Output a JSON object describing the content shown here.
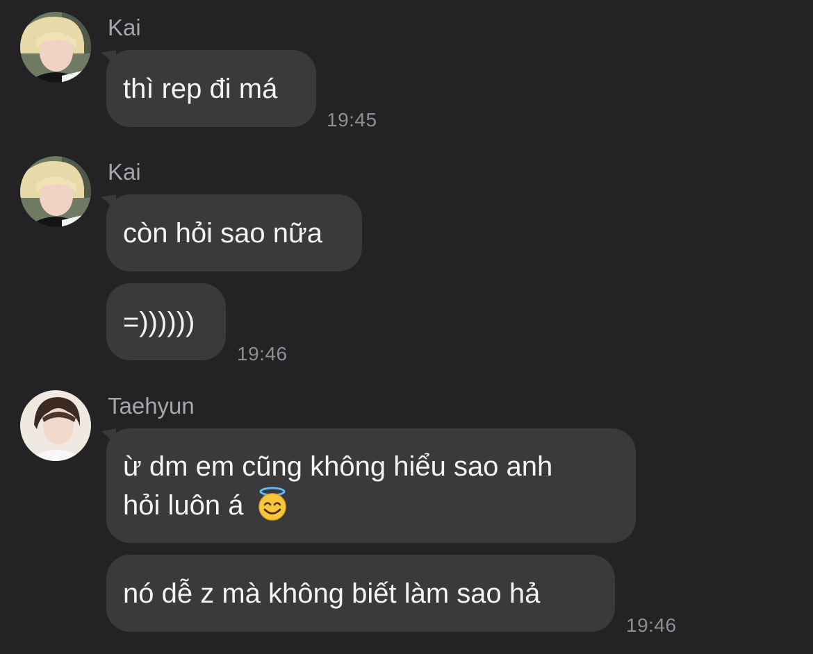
{
  "messages": [
    {
      "sender": "Kai",
      "bubbles": [
        "thì rep đi má"
      ],
      "time": "19:45"
    },
    {
      "sender": "Kai",
      "bubbles": [
        "còn hỏi sao nữa",
        "=))))))"
      ],
      "time": "19:46"
    },
    {
      "sender": "Taehyun",
      "bubbles": [
        {
          "line1": "ừ dm em cũng không hiểu sao anh",
          "line2": "hỏi luôn á",
          "emoji": "smiling-face-with-halo"
        },
        "nó dễ z mà không biết làm sao hả"
      ],
      "time": "19:46"
    }
  ],
  "colors": {
    "background": "#232325",
    "bubble": "#3a3a3d",
    "sender_name": "#a7a7ab",
    "timestamp": "#8e8e93"
  }
}
